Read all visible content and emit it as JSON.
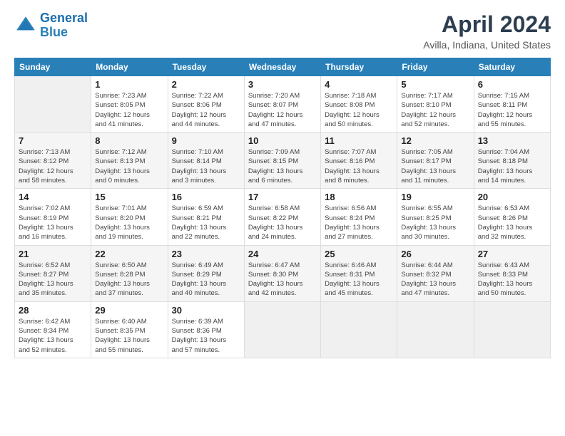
{
  "header": {
    "logo_line1": "General",
    "logo_line2": "Blue",
    "month_title": "April 2024",
    "location": "Avilla, Indiana, United States"
  },
  "days_of_week": [
    "Sunday",
    "Monday",
    "Tuesday",
    "Wednesday",
    "Thursday",
    "Friday",
    "Saturday"
  ],
  "weeks": [
    [
      {
        "day": "",
        "info": ""
      },
      {
        "day": "1",
        "info": "Sunrise: 7:23 AM\nSunset: 8:05 PM\nDaylight: 12 hours\nand 41 minutes."
      },
      {
        "day": "2",
        "info": "Sunrise: 7:22 AM\nSunset: 8:06 PM\nDaylight: 12 hours\nand 44 minutes."
      },
      {
        "day": "3",
        "info": "Sunrise: 7:20 AM\nSunset: 8:07 PM\nDaylight: 12 hours\nand 47 minutes."
      },
      {
        "day": "4",
        "info": "Sunrise: 7:18 AM\nSunset: 8:08 PM\nDaylight: 12 hours\nand 50 minutes."
      },
      {
        "day": "5",
        "info": "Sunrise: 7:17 AM\nSunset: 8:10 PM\nDaylight: 12 hours\nand 52 minutes."
      },
      {
        "day": "6",
        "info": "Sunrise: 7:15 AM\nSunset: 8:11 PM\nDaylight: 12 hours\nand 55 minutes."
      }
    ],
    [
      {
        "day": "7",
        "info": "Sunrise: 7:13 AM\nSunset: 8:12 PM\nDaylight: 12 hours\nand 58 minutes."
      },
      {
        "day": "8",
        "info": "Sunrise: 7:12 AM\nSunset: 8:13 PM\nDaylight: 13 hours\nand 0 minutes."
      },
      {
        "day": "9",
        "info": "Sunrise: 7:10 AM\nSunset: 8:14 PM\nDaylight: 13 hours\nand 3 minutes."
      },
      {
        "day": "10",
        "info": "Sunrise: 7:09 AM\nSunset: 8:15 PM\nDaylight: 13 hours\nand 6 minutes."
      },
      {
        "day": "11",
        "info": "Sunrise: 7:07 AM\nSunset: 8:16 PM\nDaylight: 13 hours\nand 8 minutes."
      },
      {
        "day": "12",
        "info": "Sunrise: 7:05 AM\nSunset: 8:17 PM\nDaylight: 13 hours\nand 11 minutes."
      },
      {
        "day": "13",
        "info": "Sunrise: 7:04 AM\nSunset: 8:18 PM\nDaylight: 13 hours\nand 14 minutes."
      }
    ],
    [
      {
        "day": "14",
        "info": "Sunrise: 7:02 AM\nSunset: 8:19 PM\nDaylight: 13 hours\nand 16 minutes."
      },
      {
        "day": "15",
        "info": "Sunrise: 7:01 AM\nSunset: 8:20 PM\nDaylight: 13 hours\nand 19 minutes."
      },
      {
        "day": "16",
        "info": "Sunrise: 6:59 AM\nSunset: 8:21 PM\nDaylight: 13 hours\nand 22 minutes."
      },
      {
        "day": "17",
        "info": "Sunrise: 6:58 AM\nSunset: 8:22 PM\nDaylight: 13 hours\nand 24 minutes."
      },
      {
        "day": "18",
        "info": "Sunrise: 6:56 AM\nSunset: 8:24 PM\nDaylight: 13 hours\nand 27 minutes."
      },
      {
        "day": "19",
        "info": "Sunrise: 6:55 AM\nSunset: 8:25 PM\nDaylight: 13 hours\nand 30 minutes."
      },
      {
        "day": "20",
        "info": "Sunrise: 6:53 AM\nSunset: 8:26 PM\nDaylight: 13 hours\nand 32 minutes."
      }
    ],
    [
      {
        "day": "21",
        "info": "Sunrise: 6:52 AM\nSunset: 8:27 PM\nDaylight: 13 hours\nand 35 minutes."
      },
      {
        "day": "22",
        "info": "Sunrise: 6:50 AM\nSunset: 8:28 PM\nDaylight: 13 hours\nand 37 minutes."
      },
      {
        "day": "23",
        "info": "Sunrise: 6:49 AM\nSunset: 8:29 PM\nDaylight: 13 hours\nand 40 minutes."
      },
      {
        "day": "24",
        "info": "Sunrise: 6:47 AM\nSunset: 8:30 PM\nDaylight: 13 hours\nand 42 minutes."
      },
      {
        "day": "25",
        "info": "Sunrise: 6:46 AM\nSunset: 8:31 PM\nDaylight: 13 hours\nand 45 minutes."
      },
      {
        "day": "26",
        "info": "Sunrise: 6:44 AM\nSunset: 8:32 PM\nDaylight: 13 hours\nand 47 minutes."
      },
      {
        "day": "27",
        "info": "Sunrise: 6:43 AM\nSunset: 8:33 PM\nDaylight: 13 hours\nand 50 minutes."
      }
    ],
    [
      {
        "day": "28",
        "info": "Sunrise: 6:42 AM\nSunset: 8:34 PM\nDaylight: 13 hours\nand 52 minutes."
      },
      {
        "day": "29",
        "info": "Sunrise: 6:40 AM\nSunset: 8:35 PM\nDaylight: 13 hours\nand 55 minutes."
      },
      {
        "day": "30",
        "info": "Sunrise: 6:39 AM\nSunset: 8:36 PM\nDaylight: 13 hours\nand 57 minutes."
      },
      {
        "day": "",
        "info": ""
      },
      {
        "day": "",
        "info": ""
      },
      {
        "day": "",
        "info": ""
      },
      {
        "day": "",
        "info": ""
      }
    ]
  ]
}
